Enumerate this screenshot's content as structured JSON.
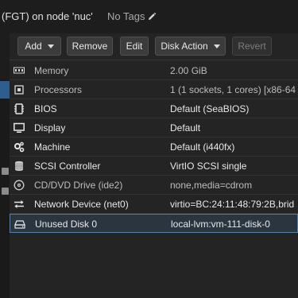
{
  "header": {
    "title": "(FGT) on node 'nuc'",
    "tags_label": "No Tags"
  },
  "toolbar": {
    "add_label": "Add",
    "remove_label": "Remove",
    "edit_label": "Edit",
    "disk_action_label": "Disk Action",
    "revert_label": "Revert"
  },
  "hardware": [
    {
      "icon": "memory-icon",
      "key": "Memory",
      "value": "2.00 GiB"
    },
    {
      "icon": "processors-icon",
      "key": "Processors",
      "value": "1 (1 sockets, 1 cores) [x86-64"
    },
    {
      "icon": "bios-icon",
      "key": "BIOS",
      "value": "Default (SeaBIOS)"
    },
    {
      "icon": "display-icon",
      "key": "Display",
      "value": "Default"
    },
    {
      "icon": "machine-icon",
      "key": "Machine",
      "value": "Default (i440fx)"
    },
    {
      "icon": "scsi-controller-icon",
      "key": "SCSI Controller",
      "value": "VirtIO SCSI single"
    },
    {
      "icon": "cdrom-icon",
      "key": "CD/DVD Drive (ide2)",
      "value": "none,media=cdrom"
    },
    {
      "icon": "network-icon",
      "key": "Network Device (net0)",
      "value": "virtio=BC:24:11:48:79:2B,brid"
    },
    {
      "icon": "hard-disk-icon",
      "key": "Unused Disk 0",
      "value": "local-lvm:vm-111-disk-0"
    }
  ]
}
